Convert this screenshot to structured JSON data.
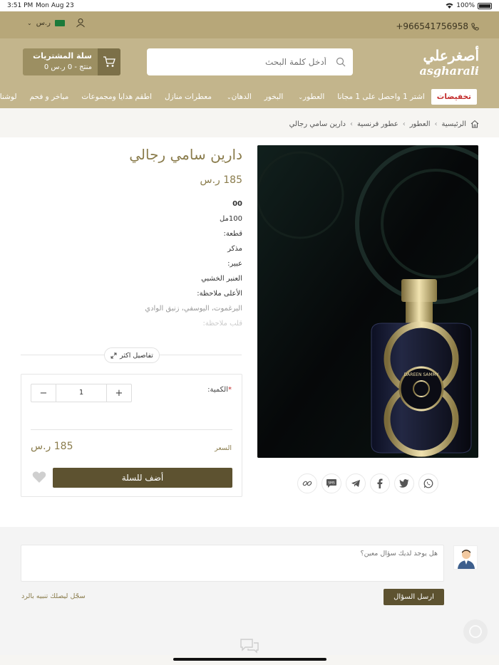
{
  "status_bar": {
    "time": "3:51 PM",
    "date": "Mon Aug 23",
    "battery": "100%"
  },
  "topbar": {
    "phone": "+966541756958",
    "currency": "ر.س"
  },
  "header": {
    "logo_arabic": "أصغرعلي",
    "logo_latin": "asgharali",
    "search_placeholder": "أدخل كلمة البحث",
    "cart_title": "سلة المشتريات",
    "cart_summary": "0 منتج - 0 ر.س"
  },
  "nav": {
    "items": [
      {
        "label": "تخفيضات",
        "sale": true,
        "caret": false
      },
      {
        "label": "اشتر 1 واحصل على 1 مجانا",
        "caret": false
      },
      {
        "label": "العطور",
        "caret": true
      },
      {
        "label": "البخور",
        "caret": false
      },
      {
        "label": "الدهان",
        "caret": true
      },
      {
        "label": "معطرات منازل",
        "caret": false
      },
      {
        "label": "اطقم هدايا ومجموعات",
        "caret": false
      },
      {
        "label": "مباخر و فحم",
        "caret": false
      },
      {
        "label": "لوشنات",
        "caret": false
      }
    ]
  },
  "breadcrumb": [
    "الرئيسية",
    "العطور",
    "عطور فرنسية",
    "دارين سامي رجالي"
  ],
  "product": {
    "title": "دارين سامي رجالي",
    "price": "185 ر.س",
    "specs": [
      {
        "text": "00",
        "style": "b"
      },
      {
        "text": "100مل",
        "style": ""
      },
      {
        "text": "قطعة:",
        "style": ""
      },
      {
        "text": "مذكر",
        "style": ""
      },
      {
        "text": "عبير:",
        "style": ""
      },
      {
        "text": "العنبر الخشبي",
        "style": ""
      },
      {
        "text": "الأعلى ملاحظة:",
        "style": ""
      },
      {
        "text": "البرغموت، اليوسفي، زنبق الوادي",
        "style": "faded"
      },
      {
        "text": "قلب ملاحظة:",
        "style": "faded2"
      }
    ],
    "more_details": "تفاصيل اكثر",
    "bottle_label": "DAREEN SAMMY"
  },
  "buybox": {
    "qty_label": "الكمية:",
    "required_mark": "*",
    "qty_value": "1",
    "minus": "−",
    "plus": "+",
    "price_label": "السعر",
    "price_value": "185 ر.س",
    "add_to_cart": "أضف للسلة"
  },
  "qa": {
    "placeholder": "هل يوجد لديك سؤال معين؟",
    "send": "ارسل السؤال",
    "login_hint": "سجّل ليصلك تنبيه بالرد"
  },
  "colors": {
    "gold": "#c3b58c",
    "dark_gold": "#5d5230",
    "sale_red": "#c32c2c"
  }
}
